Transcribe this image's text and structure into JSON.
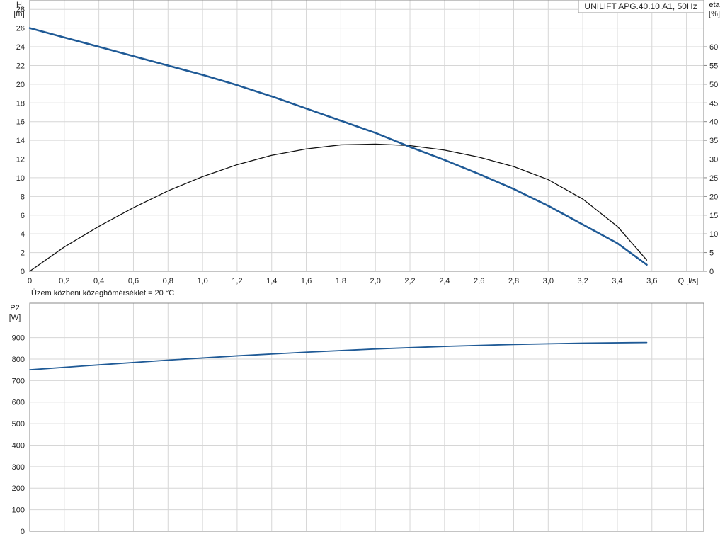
{
  "chart_data": [
    {
      "type": "line",
      "panel": "head-efficiency",
      "legend_label": "UNILIFT APG.40.10.A1, 50Hz",
      "legend_placement": "top-right",
      "note": "Üzem közbeni közeghőmérséklet = 20 °C",
      "grid": true,
      "colors": {
        "head_curve": "#1f5a96",
        "eta_curve": "#111111",
        "grid": "#d6d6d6",
        "frame": "#888888"
      },
      "x_axis": {
        "label": "Q [l/s]",
        "range": [
          0,
          3.9
        ],
        "ticks": [
          "0",
          "0,2",
          "0,4",
          "0,6",
          "0,8",
          "1,0",
          "1,2",
          "1,4",
          "1,6",
          "1,8",
          "2,0",
          "2,2",
          "2,4",
          "2,6",
          "2,8",
          "3,0",
          "3,2",
          "3,4",
          "3,6"
        ]
      },
      "y_left": {
        "label_top": "H",
        "label_unit": "[m]",
        "range": [
          0,
          29
        ],
        "ticks": [
          "0",
          "2",
          "4",
          "6",
          "8",
          "10",
          "12",
          "14",
          "16",
          "18",
          "20",
          "22",
          "24",
          "26",
          "28"
        ]
      },
      "y_right": {
        "label_top": "eta",
        "label_unit": "[%]",
        "range": [
          0,
          72.5
        ],
        "ticks": [
          "0",
          "5",
          "10",
          "15",
          "20",
          "25",
          "30",
          "35",
          "40",
          "45",
          "50",
          "55",
          "60"
        ]
      },
      "series": [
        {
          "key": "head",
          "axis": "left",
          "x": [
            0,
            0.2,
            0.4,
            0.6,
            0.8,
            1.0,
            1.2,
            1.4,
            1.6,
            1.8,
            2.0,
            2.2,
            2.4,
            2.6,
            2.8,
            3.0,
            3.2,
            3.4,
            3.57
          ],
          "values": [
            26.0,
            25.0,
            24.0,
            23.0,
            22.0,
            21.0,
            19.9,
            18.7,
            17.4,
            16.1,
            14.8,
            13.3,
            11.9,
            10.4,
            8.8,
            7.0,
            5.0,
            3.0,
            0.7
          ]
        },
        {
          "key": "eta",
          "axis": "right",
          "x": [
            0,
            0.2,
            0.4,
            0.6,
            0.8,
            1.0,
            1.2,
            1.4,
            1.6,
            1.8,
            2.0,
            2.2,
            2.4,
            2.6,
            2.8,
            3.0,
            3.2,
            3.4,
            3.57
          ],
          "values": [
            0,
            6.5,
            12.0,
            17.0,
            21.5,
            25.3,
            28.5,
            31.0,
            32.7,
            33.8,
            34.0,
            33.6,
            32.4,
            30.5,
            28.0,
            24.5,
            19.3,
            12.0,
            3.0
          ]
        }
      ]
    },
    {
      "type": "line",
      "panel": "power",
      "grid": true,
      "colors": {
        "power_curve": "#1f5a96",
        "grid": "#d6d6d6",
        "frame": "#888888"
      },
      "x_axis": {
        "range": [
          0,
          3.9
        ]
      },
      "y_left": {
        "label_top": "P2",
        "label_unit": "[W]",
        "range": [
          0,
          1060
        ],
        "ticks": [
          "0",
          "100",
          "200",
          "300",
          "400",
          "500",
          "600",
          "700",
          "800",
          "900"
        ]
      },
      "series": [
        {
          "key": "p2",
          "axis": "left",
          "x": [
            0,
            0.4,
            0.8,
            1.2,
            1.6,
            2.0,
            2.4,
            2.8,
            3.2,
            3.57
          ],
          "values": [
            750,
            773,
            795,
            815,
            832,
            847,
            859,
            868,
            874,
            877
          ]
        }
      ]
    }
  ]
}
